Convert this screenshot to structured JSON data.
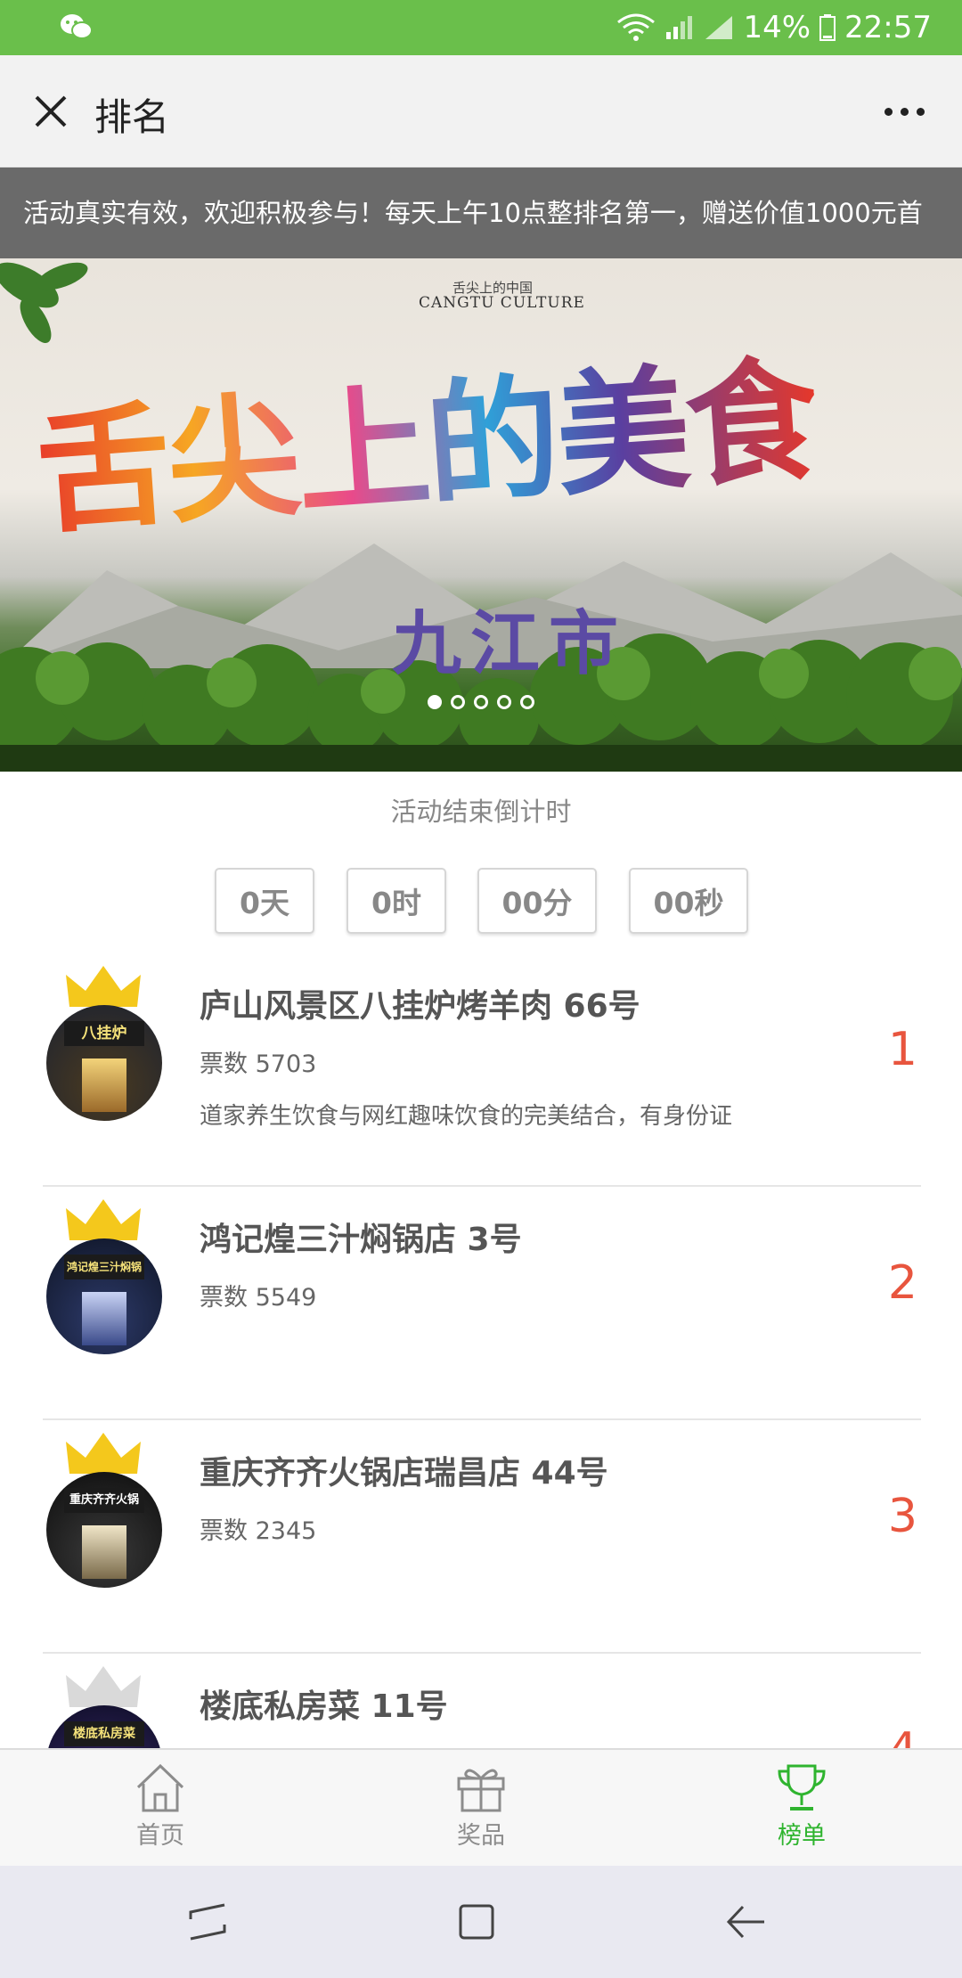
{
  "status_bar": {
    "battery": "14%",
    "time": "22:57",
    "app_icon": "wechat-icon"
  },
  "title_bar": {
    "title": "排名",
    "close_icon": "close-icon",
    "more_icon": "more-icon"
  },
  "marquee": {
    "text": "活动真实有效，欢迎积极参与！每天上午10点整排名第一，赠送价值1000元首"
  },
  "banner": {
    "subtitle_cn": "舌尖上的中国",
    "subtitle_en": "CANGTU CULTURE",
    "headline": "舌尖上的美食",
    "city": "九江市",
    "slide_count": 5,
    "active_slide": 1
  },
  "countdown": {
    "label": "活动结束倒计时",
    "days": "0天",
    "hours": "0时",
    "minutes": "00分",
    "seconds": "00秒"
  },
  "ranking": [
    {
      "name": "庐山风景区八挂炉烤羊肉  66号",
      "votes": "票数 5703",
      "desc": "道家养生饮食与网红趣味饮食的完美结合，有身份证",
      "rank": "1",
      "avatar_sign": "八挂炉",
      "crown_color": "#f4c81c"
    },
    {
      "name": "鸿记煌三汁焖锅店  3号",
      "votes": "票数 5549",
      "desc": "",
      "rank": "2",
      "avatar_sign": "鸿记煌三汁焖锅",
      "crown_color": "#f4c81c"
    },
    {
      "name": "重庆齐齐火锅店瑞昌店  44号",
      "votes": "票数 2345",
      "desc": "",
      "rank": "3",
      "avatar_sign": "重庆齐齐火锅",
      "crown_color": "#f4c81c"
    },
    {
      "name": "楼底私房菜  11号",
      "votes": "",
      "desc": "",
      "rank": "4",
      "avatar_sign": "楼底私房菜",
      "crown_color": "#d9d9d9"
    }
  ],
  "tab_bar": {
    "tabs": [
      {
        "label": "首页",
        "icon": "home-icon",
        "active": false
      },
      {
        "label": "奖品",
        "icon": "gift-icon",
        "active": false
      },
      {
        "label": "榜单",
        "icon": "trophy-icon",
        "active": true
      }
    ],
    "active_color": "#2fb42f",
    "inactive_color": "#8c8c8c"
  },
  "nav_bar": {
    "buttons": [
      "recent-apps-icon",
      "home-button-icon",
      "back-icon"
    ]
  }
}
